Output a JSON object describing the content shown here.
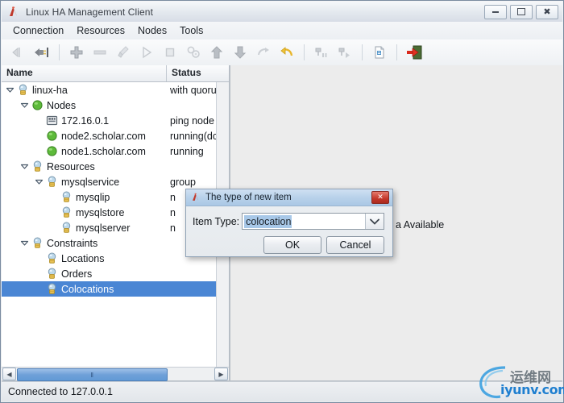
{
  "window": {
    "title": "Linux HA Management Client",
    "icon": "app-icon",
    "buttons": {
      "minimize": "–",
      "maximize": "□",
      "close": "✕"
    }
  },
  "menubar": {
    "items": [
      {
        "label": "Connection"
      },
      {
        "label": "Resources"
      },
      {
        "label": "Nodes"
      },
      {
        "label": "Tools"
      }
    ]
  },
  "toolbar": {
    "items": [
      {
        "name": "disconnect-icon",
        "enabled": false
      },
      {
        "name": "connect-icon",
        "enabled": true
      },
      {
        "name": "separator"
      },
      {
        "name": "add-icon",
        "enabled": true
      },
      {
        "name": "remove-icon",
        "enabled": false
      },
      {
        "name": "cleanup-brush-icon",
        "enabled": false
      },
      {
        "name": "start-icon",
        "enabled": false
      },
      {
        "name": "stop-icon",
        "enabled": false
      },
      {
        "name": "manage-gears-icon",
        "enabled": false
      },
      {
        "name": "move-up-icon",
        "enabled": true
      },
      {
        "name": "move-down-icon",
        "enabled": true
      },
      {
        "name": "migrate-icon",
        "enabled": false
      },
      {
        "name": "unmigrate-icon",
        "enabled": true
      },
      {
        "name": "separator"
      },
      {
        "name": "standby-icon",
        "enabled": false
      },
      {
        "name": "activate-icon",
        "enabled": false
      },
      {
        "name": "separator"
      },
      {
        "name": "properties-document-icon",
        "enabled": true
      },
      {
        "name": "separator"
      },
      {
        "name": "exit-icon",
        "enabled": true
      }
    ]
  },
  "tree": {
    "columns": {
      "name": "Name",
      "status": "Status"
    },
    "rows": [
      {
        "name": "linux-ha",
        "status": "with quorum",
        "indent": 0,
        "twisty": "open",
        "icon": "bulb-icon",
        "selected": false
      },
      {
        "name": "Nodes",
        "status": "",
        "indent": 1,
        "twisty": "open",
        "icon": "green-ball-icon",
        "selected": false
      },
      {
        "name": "172.16.0.1",
        "status": "ping node",
        "indent": 2,
        "twisty": "none",
        "icon": "ping-node-icon",
        "selected": false
      },
      {
        "name": "node2.scholar.com",
        "status": "running(dc)",
        "indent": 2,
        "twisty": "none",
        "icon": "green-ball-icon",
        "selected": false
      },
      {
        "name": "node1.scholar.com",
        "status": "running",
        "indent": 2,
        "twisty": "none",
        "icon": "green-ball-icon",
        "selected": false
      },
      {
        "name": "Resources",
        "status": "",
        "indent": 1,
        "twisty": "open",
        "icon": "bulb-icon",
        "selected": false
      },
      {
        "name": "mysqlservice",
        "status": "group",
        "indent": 2,
        "twisty": "open",
        "icon": "bulb-icon",
        "selected": false
      },
      {
        "name": "mysqlip",
        "status": "n",
        "indent": 3,
        "twisty": "none",
        "icon": "bulb-icon",
        "selected": false
      },
      {
        "name": "mysqlstore",
        "status": "n",
        "indent": 3,
        "twisty": "none",
        "icon": "bulb-icon",
        "selected": false
      },
      {
        "name": "mysqlserver",
        "status": "n",
        "indent": 3,
        "twisty": "none",
        "icon": "bulb-icon",
        "selected": false
      },
      {
        "name": "Constraints",
        "status": "",
        "indent": 1,
        "twisty": "open",
        "icon": "bulb-icon",
        "selected": false
      },
      {
        "name": "Locations",
        "status": "",
        "indent": 2,
        "twisty": "none",
        "icon": "bulb-icon",
        "selected": false
      },
      {
        "name": "Orders",
        "status": "",
        "indent": 2,
        "twisty": "none",
        "icon": "bulb-icon",
        "selected": false
      },
      {
        "name": "Colocations",
        "status": "",
        "indent": 2,
        "twisty": "none",
        "icon": "bulb-icon",
        "selected": true
      }
    ],
    "hscroll_grip": "‖"
  },
  "right_panel": {
    "text": "a Available"
  },
  "dialog": {
    "title": "The type of new item",
    "icon": "app-icon",
    "close_label": "✕",
    "field_label": "Item Type:",
    "field_value": "colocation",
    "dropdown_icon": "chevron-down-icon",
    "ok_label": "OK",
    "cancel_label": "Cancel"
  },
  "statusbar": {
    "text": "Connected to 127.0.0.1"
  },
  "watermark": {
    "cn": "运维网",
    "en": "iyunv.com",
    "color": "#1f7fd0"
  },
  "colors": {
    "selection": "#4a86d4",
    "dialog_title": "#b9d2ea",
    "close_red": "#c4372a",
    "node_green": "#5dba3a"
  }
}
